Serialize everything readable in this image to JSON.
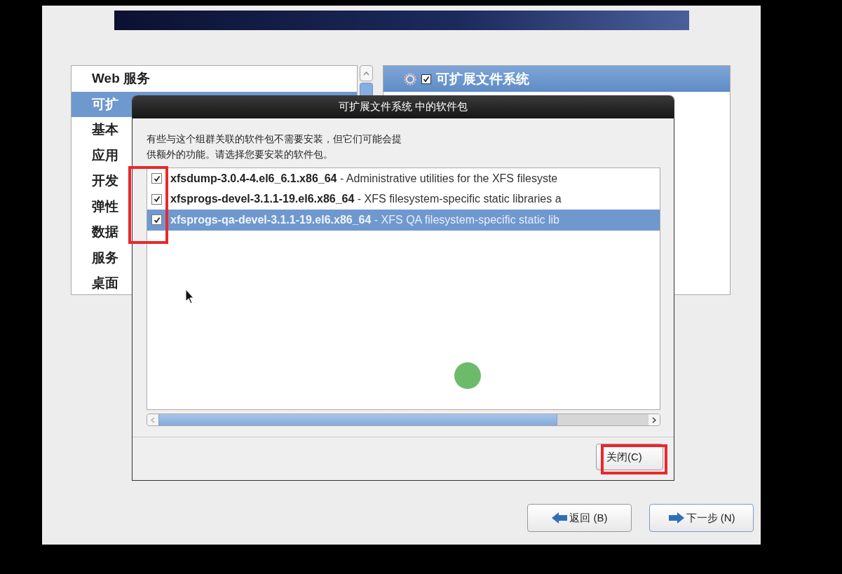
{
  "groups": [
    {
      "label": "Web 服务",
      "selected": false
    },
    {
      "label": "可扩",
      "selected": true
    },
    {
      "label": "基本",
      "selected": false
    },
    {
      "label": "应用",
      "selected": false
    },
    {
      "label": "开发",
      "selected": false
    },
    {
      "label": "弹性",
      "selected": false
    },
    {
      "label": "数据",
      "selected": false
    },
    {
      "label": "服务",
      "selected": false
    },
    {
      "label": "桌面",
      "selected": false
    }
  ],
  "group_detail": {
    "title": "可扩展文件系统",
    "checked": true
  },
  "dialog": {
    "title": "可扩展文件系统 中的软件包",
    "message": "有些与这个组群关联的软件包不需要安装，但它们可能会提供额外的功能。请选择您要安装的软件包。",
    "packages": [
      {
        "text": "**xfsdump-3.0.4-4.el6_6.1.x86_64** - Administrative utilities for the XFS filesyste",
        "checked": true,
        "selected": false
      },
      {
        "text": "**xfsprogs-devel-3.1.1-19.el6.x86_64** - XFS filesystem-specific static libraries a",
        "checked": true,
        "selected": false
      },
      {
        "text": "**xfsprogs-qa-devel-3.1.1-19.el6.x86_64** - XFS QA filesystem-specific static lib",
        "checked": true,
        "selected": true
      }
    ],
    "close_button": "关闭(C)"
  },
  "buttons": [
    {
      "label": "返回 (B)",
      "kind": "back"
    },
    {
      "label": "下一步 (N)",
      "kind": "next"
    }
  ]
}
